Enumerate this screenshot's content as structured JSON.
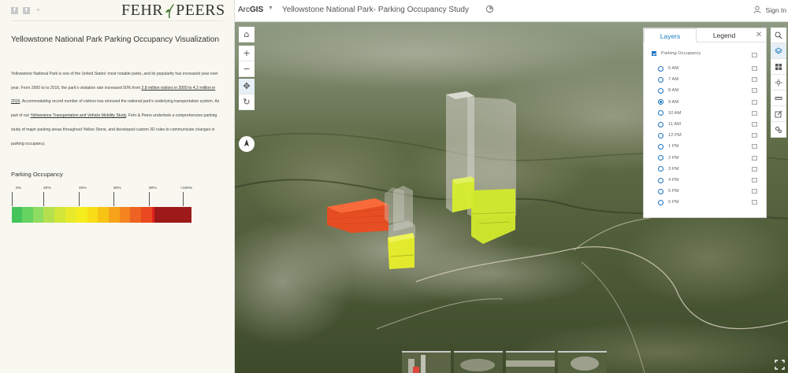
{
  "left_panel": {
    "brand": {
      "part1": "FEHR",
      "part2": "PEERS"
    },
    "social_icons": [
      "facebook-icon",
      "twitter-icon",
      "link-icon"
    ],
    "title": "Yellowstone National Park Parking Occupancy Visualization",
    "intro": {
      "p1": "Yellowstone National Park is one of the United States' most notable parks, and its popularity has increased year over year. From 2000 to to 2016, the park's visitation rate increased 50% from ",
      "link1": "2.8 million visitors in 2000 to 4.2 million in 2016",
      "p2": ". Accommodating record number of visitors has stressed the national park's underlying transportation system. As part of our ",
      "link2": "Yellowstone Transportation and Vehicle Mobility Study",
      "p3": ", Fehr & Peers undertook a comprehensive parking study of major parking areas throughout Yellow Stone, and developed custom 3D rules to communicate changes in parking occupancy."
    },
    "occupancy": {
      "title": "Parking Occupancy",
      "ticks": [
        "0%",
        "20%",
        "40%",
        "60%",
        "80%",
        ">100%"
      ],
      "colors": [
        "#44c55a",
        "#66d260",
        "#8fdc62",
        "#b5e04e",
        "#d1e639",
        "#e8e92a",
        "#f5ec1e",
        "#f9dd18",
        "#f7c315",
        "#f6a31a",
        "#f3841f",
        "#ee6322",
        "#ea4820",
        "#e0231d",
        "#9e1a1a"
      ]
    }
  },
  "topbar": {
    "app": "ArcGIS",
    "scene_title": "Yellowstone National Park- Parking Occupancy Study",
    "signin": "Sign In"
  },
  "map": {
    "nav_buttons": [
      {
        "name": "home-button",
        "glyph": "⌂"
      },
      {
        "name": "zoom-in-button",
        "glyph": "+"
      },
      {
        "name": "zoom-out-button",
        "glyph": "−"
      },
      {
        "name": "pan-button",
        "glyph": "✥"
      },
      {
        "name": "rotate-button",
        "glyph": "↻"
      }
    ],
    "layer_panel": {
      "tabs": [
        "Layers",
        "Legend"
      ],
      "close_glyph": "✕",
      "parent_layer": "Parking Occupancy",
      "times": [
        "6 AM",
        "7 AM",
        "8 AM",
        "9 AM",
        "10 AM",
        "11 AM",
        "12 PM",
        "1 PM",
        "2 PM",
        "3 PM",
        "4 PM",
        "5 PM",
        "6 PM"
      ],
      "selected_time": "9 AM"
    },
    "right_tools": [
      "search-icon",
      "layers-icon",
      "basemap-icon",
      "daylight-icon",
      "measure-icon",
      "share-icon",
      "settings-icon"
    ],
    "bars": [
      {
        "name": "lot-left",
        "occupancy_color": "#ef4a1e"
      },
      {
        "name": "lot-center",
        "occupancy_color": "#e8ef2a"
      },
      {
        "name": "lot-right",
        "occupancy_color": "#d6ee2c"
      }
    ]
  }
}
